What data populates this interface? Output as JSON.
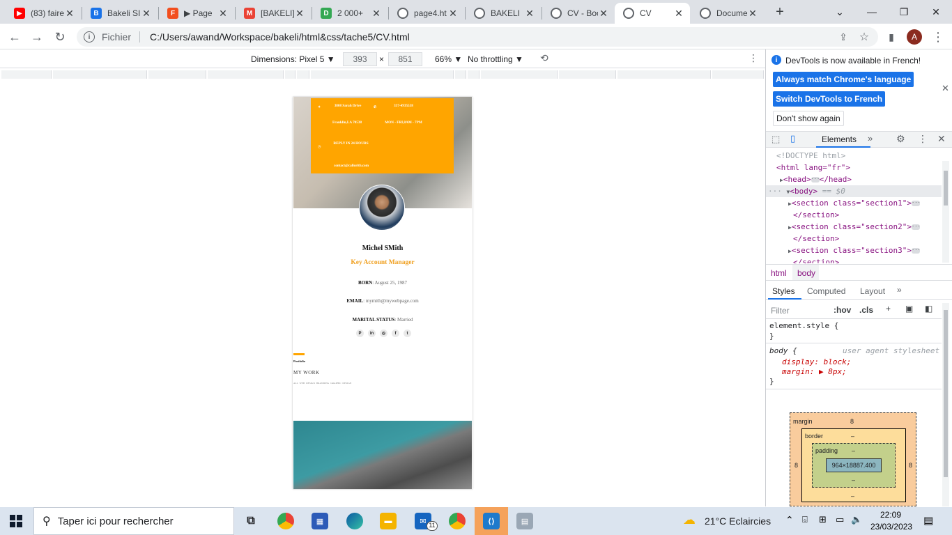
{
  "browser": {
    "tabs": [
      {
        "title": "(83) faire",
        "icon": "youtube-icon",
        "color": "#ff0000"
      },
      {
        "title": "Bakeli SI",
        "icon": "bakeli-icon",
        "color": "#1a73e8"
      },
      {
        "title": "▶ Page",
        "icon": "figma-icon",
        "color": "#f24e1e"
      },
      {
        "title": "[BAKELI]",
        "icon": "gmail-icon",
        "color": "#ea4335"
      },
      {
        "title": "2 000+",
        "icon": "d-icon",
        "color": "#34a853"
      },
      {
        "title": "page4.ht",
        "icon": "globe-icon",
        "color": "#5f6368"
      },
      {
        "title": "BAKELI",
        "icon": "globe-icon",
        "color": "#5f6368"
      },
      {
        "title": "CV - Boo",
        "icon": "globe-icon",
        "color": "#5f6368"
      },
      {
        "title": "CV",
        "icon": "globe-icon",
        "color": "#5f6368"
      },
      {
        "title": "Docume",
        "icon": "globe-icon",
        "color": "#5f6368"
      }
    ],
    "new_tab": "+",
    "address": {
      "scheme": "Fichier",
      "url": "C:/Users/awand/Workspace/bakeli/html&css/tache5/CV.html"
    },
    "avatar": "A"
  },
  "device_toolbar": {
    "dimensions_label": "Dimensions: Pixel 5 ▼",
    "width": "393",
    "times": "×",
    "height": "851",
    "zoom": "66% ▼",
    "throttling": "No throttling ▼"
  },
  "cv": {
    "contact": {
      "address": "3808 Sarah Drive",
      "phone": "337-4935558",
      "city": "Franklin,LA 70538",
      "hours": "MON - FRI,8AM - 7PM",
      "reply": "REPLY IN 24 HOURS",
      "email": "contact@callorith.com"
    },
    "name": "Michel SMith",
    "role": "Key Account Manager",
    "born_label": "BORN",
    "born_value": ": August 25, 1987",
    "email_label": "EMAIL",
    "email_value": ": mymith@mywebpage.com",
    "marital_label": "MARITAL STATUS",
    "marital_value": ": Married",
    "socials": [
      "P",
      "in",
      "◎",
      "f",
      "t"
    ],
    "portfolio_label": "Portfolio",
    "mywork": "MY WORK",
    "filters": "ALL   WEB DESIGN   BRANDING   GRAPHIC DESIGN"
  },
  "devtools": {
    "notice": "DevTools is now available in French!",
    "btn_match": "Always match Chrome's language",
    "btn_switch": "Switch DevTools to French",
    "btn_dont": "Don't show again",
    "tab_elements": "Elements",
    "dom": {
      "doctype": "<!DOCTYPE html>",
      "html_open": "<html lang=\"fr\">",
      "head": "<head>",
      "head_close": "</head>",
      "body": "<body>",
      "body_eq": "== $0",
      "sec1": "<section class=\"section1\">",
      "sec2": "<section class=\"section2\">",
      "sec3": "<section class=\"section3\">",
      "sec_close": "</section>"
    },
    "breadcrumb": [
      "html",
      "body"
    ],
    "styles_tabs": [
      "Styles",
      "Computed",
      "Layout"
    ],
    "filter_placeholder": "Filter",
    "hov": ":hov",
    "cls": ".cls",
    "rule1_selector": "element.style {",
    "rule_close": "}",
    "rule2_selector": "body {",
    "rule2_origin": "user agent stylesheet",
    "rule2_prop1": "display: block;",
    "rule2_prop2": "margin: ▶ 8px;",
    "boxmodel": {
      "margin_label": "margin",
      "margin_value": "8",
      "border_label": "border",
      "border_value": "–",
      "padding_label": "padding",
      "padding_value": "–",
      "content": "964×18887.400",
      "side_value": "8",
      "dash": "–"
    }
  },
  "taskbar": {
    "search_placeholder": "Taper ici pour rechercher",
    "weather": "21°C  Eclaircies",
    "time": "22:09",
    "date": "23/03/2023",
    "mail_badge": "11"
  }
}
